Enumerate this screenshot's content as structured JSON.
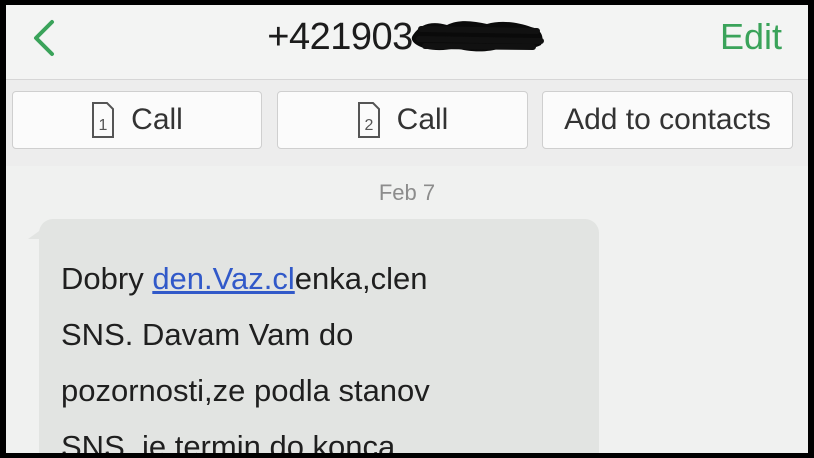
{
  "header": {
    "back_icon": "chevron-left-icon",
    "phone_number_visible": "+421903",
    "edit_label": "Edit",
    "accent_color": "#3aa35a"
  },
  "actions": [
    {
      "icon": "sim-1-icon",
      "sim_number": "1",
      "label": "Call"
    },
    {
      "icon": "sim-2-icon",
      "sim_number": "2",
      "label": "Call"
    },
    {
      "label": "Add to contacts"
    }
  ],
  "conversation": {
    "date": "Feb 7",
    "message": {
      "before_link": "Dobry ",
      "link": "den.Vaz.cl",
      "after_link": "enka,clen",
      "lines": [
        "SNS. Davam Vam do",
        "pozornosti,ze podla stanov",
        "SNS ,je termin do konca"
      ]
    },
    "link_color": "#3159c9"
  }
}
